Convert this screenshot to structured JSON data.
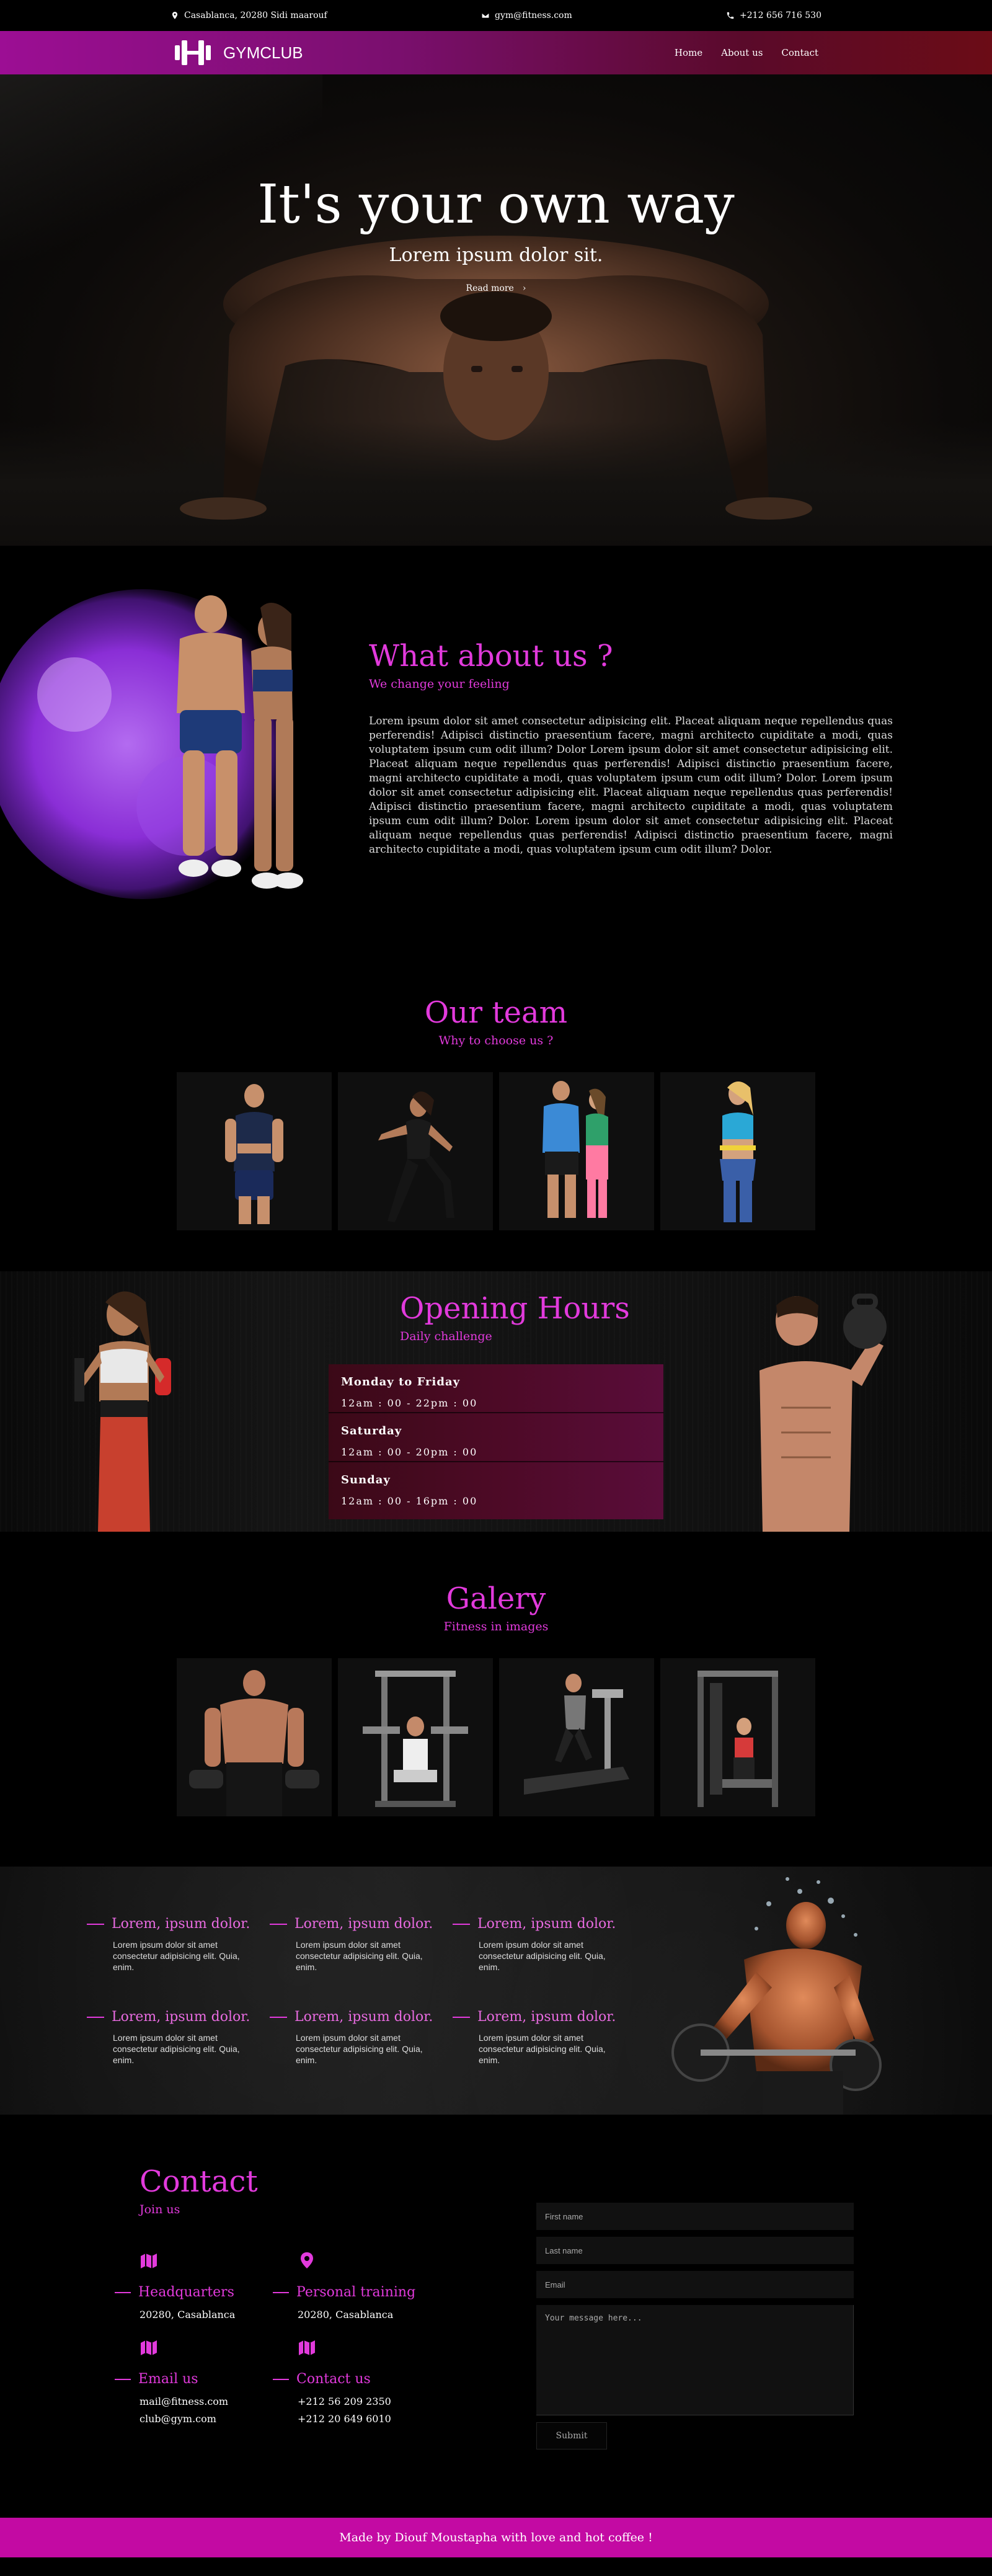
{
  "topbar": {
    "address": "Casablanca, 20280 Sidi maarouf",
    "email": "gym@fitness.com",
    "phone": "+212 656 716 530"
  },
  "nav": {
    "brand": "GYMCLUB",
    "links": [
      "Home",
      "About us",
      "Contact"
    ]
  },
  "hero": {
    "title": "It's your own way",
    "subtitle": "Lorem ipsum dolor sit.",
    "button": "Read more"
  },
  "about": {
    "title": "What about us ?",
    "subtitle": "We change your feeling",
    "paragraph": "Lorem ipsum dolor sit amet consectetur adipisicing elit. Placeat aliquam neque repellendus quas perferendis! Adipisci distinctio praesentium facere, magni architecto cupiditate a modi, quas voluptatem ipsum cum odit illum? Dolor Lorem ipsum dolor sit amet consectetur adipisicing elit. Placeat aliquam neque repellendus quas perferendis! Adipisci distinctio praesentium facere, magni architecto cupiditate a modi, quas voluptatem ipsum cum odit illum? Dolor. Lorem ipsum dolor sit amet consectetur adipisicing elit. Placeat aliquam neque repellendus quas perferendis! Adipisci distinctio praesentium facere, magni architecto cupiditate a modi, quas voluptatem ipsum cum odit illum? Dolor. Lorem ipsum dolor sit amet consectetur adipisicing elit. Placeat aliquam neque repellendus quas perferendis! Adipisci distinctio praesentium facere, magni architecto cupiditate a modi, quas voluptatem ipsum cum odit illum? Dolor."
  },
  "team": {
    "title": "Our team",
    "subtitle": "Why to choose us ?"
  },
  "hours": {
    "title": "Opening Hours",
    "subtitle": "Daily challenge",
    "rows": [
      {
        "day": "Monday to Friday",
        "time": "12am : 00 - 22pm : 00"
      },
      {
        "day": "Saturday",
        "time": "12am : 00 - 20pm : 00"
      },
      {
        "day": "Sunday",
        "time": "12am : 00 - 16pm : 00"
      }
    ]
  },
  "gallery": {
    "title": "Galery",
    "subtitle": "Fitness in images"
  },
  "features": {
    "items": [
      {
        "title": "Lorem, ipsum dolor.",
        "body": "Lorem ipsum dolor sit amet consectetur adipisicing elit. Quia, enim."
      },
      {
        "title": "Lorem, ipsum dolor.",
        "body": "Lorem ipsum dolor sit amet consectetur adipisicing elit. Quia, enim."
      },
      {
        "title": "Lorem, ipsum dolor.",
        "body": "Lorem ipsum dolor sit amet consectetur adipisicing elit. Quia, enim."
      },
      {
        "title": "Lorem, ipsum dolor.",
        "body": "Lorem ipsum dolor sit amet consectetur adipisicing elit. Quia, enim."
      },
      {
        "title": "Lorem, ipsum dolor.",
        "body": "Lorem ipsum dolor sit amet consectetur adipisicing elit. Quia, enim."
      },
      {
        "title": "Lorem, ipsum dolor.",
        "body": "Lorem ipsum dolor sit amet consectetur adipisicing elit. Quia, enim."
      }
    ]
  },
  "contact": {
    "title": "Contact",
    "subtitle": "Join us",
    "hq_title": "Headquarters",
    "hq_value": "20280, Casablanca",
    "pt_title": "Personal training",
    "pt_value": "20280, Casablanca",
    "email_title": "Email us",
    "email_1": "mail@fitness.com",
    "email_2": "club@gym.com",
    "phone_title": "Contact us",
    "phone_1": "+212 56 209 2350",
    "phone_2": "+212 20 649 6010",
    "form": {
      "first_name": "First name",
      "last_name": "Last name",
      "email": "Email",
      "message": "Your message here...",
      "submit": "Submit"
    }
  },
  "footer": {
    "text": "Made by Diouf Moustapha with love and hot coffee !"
  },
  "colors": {
    "accent": "#e23adc",
    "footer": "#c30aa3"
  }
}
